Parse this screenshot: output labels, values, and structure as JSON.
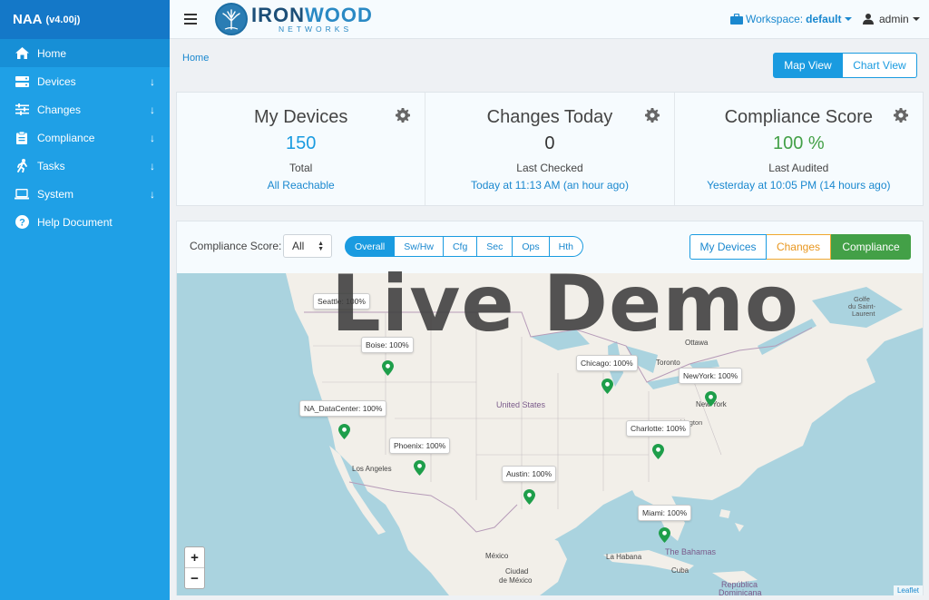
{
  "app": {
    "name": "NAA",
    "version": "(v4.00j)"
  },
  "sidebar": {
    "items": [
      {
        "label": "Home",
        "icon": "home-icon",
        "has_arrow": false
      },
      {
        "label": "Devices",
        "icon": "server-icon",
        "has_arrow": true
      },
      {
        "label": "Changes",
        "icon": "sliders-icon",
        "has_arrow": true
      },
      {
        "label": "Compliance",
        "icon": "clipboard-icon",
        "has_arrow": true
      },
      {
        "label": "Tasks",
        "icon": "running-person-icon",
        "has_arrow": true
      },
      {
        "label": "System",
        "icon": "laptop-icon",
        "has_arrow": true
      },
      {
        "label": "Help Document",
        "icon": "question-circle-icon",
        "has_arrow": false
      }
    ],
    "arrow_glyph": "↓"
  },
  "topbar": {
    "logo_main_a": "IRON",
    "logo_main_b": "WOOD",
    "logo_sub": "NETWORKS",
    "workspace_label": "Workspace:",
    "workspace_value": "default",
    "user": "admin"
  },
  "breadcrumb": "Home",
  "view_toggle": {
    "map": "Map View",
    "chart": "Chart View"
  },
  "cards": [
    {
      "title": "My Devices",
      "value": "150",
      "value_color": "#1a9be0",
      "label": "Total",
      "sub": "All Reachable"
    },
    {
      "title": "Changes Today",
      "value": "0",
      "value_color": "#333333",
      "label": "Last Checked",
      "sub": "Today at 11:13 AM (an hour ago)"
    },
    {
      "title": "Compliance Score",
      "value": "100 %",
      "value_color": "#43a047",
      "label": "Last Audited",
      "sub": "Yesterday at 10:05 PM (14 hours ago)"
    }
  ],
  "filters": {
    "label": "Compliance Score:",
    "select_value": "All",
    "pills": [
      "Overall",
      "Sw/Hw",
      "Cfg",
      "Sec",
      "Ops",
      "Hth"
    ],
    "active_pill": "Overall",
    "modes": {
      "devices": "My Devices",
      "changes": "Changes",
      "compliance": "Compliance"
    }
  },
  "map": {
    "markers": [
      {
        "label": "Seattle: 100%"
      },
      {
        "label": "Boise: 100%"
      },
      {
        "label": "NA_DataCenter: 100%"
      },
      {
        "label": "Phoenix: 100%"
      },
      {
        "label": "Austin: 100%"
      },
      {
        "label": "Chicago: 100%"
      },
      {
        "label": "Charlotte: 100%"
      },
      {
        "label": "NewYork: 100%"
      },
      {
        "label": "Miami: 100%"
      }
    ],
    "places": {
      "us": "United States",
      "la": "Los Angeles",
      "ottawa": "Ottawa",
      "toronto": "Toronto",
      "newyork": "New York",
      "washington": "Washington",
      "mexico": "México",
      "ciudad1": "Ciudad",
      "ciudad2": "de México",
      "habana": "La Habana",
      "bahamas": "The Bahamas",
      "cuba": "Cuba",
      "republica": "República",
      "dominicana": "Dominicana",
      "golfe1": "Golfe",
      "golfe2": "du Saint-",
      "golfe3": "Laurent"
    },
    "zoom_in": "+",
    "zoom_out": "−",
    "attribution": "Leaflet",
    "marker_color": "#1e9e4a"
  },
  "watermark": "Live Demo"
}
